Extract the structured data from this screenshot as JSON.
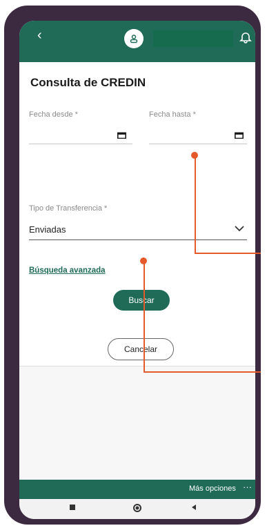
{
  "header": {
    "back_icon": "back-chevron-icon",
    "user_icon": "user-icon",
    "bell_icon": "bell-icon"
  },
  "page": {
    "title": "Consulta de CREDIN"
  },
  "form": {
    "fecha_desde_label": "Fecha desde *",
    "fecha_hasta_label": "Fecha hasta *",
    "tipo_label": "Tipo de Transferencia *",
    "tipo_value": "Enviadas",
    "advanced_link": "Búsqueda avanzada"
  },
  "actions": {
    "buscar": "Buscar",
    "cancelar": "Cancelar"
  },
  "bottombar": {
    "mas_opciones": "Más opciones",
    "more_glyph": "···"
  },
  "colors": {
    "brand_green": "#1f6b58",
    "callout_orange": "#e55a2b",
    "device_frame": "#3c2b40"
  }
}
